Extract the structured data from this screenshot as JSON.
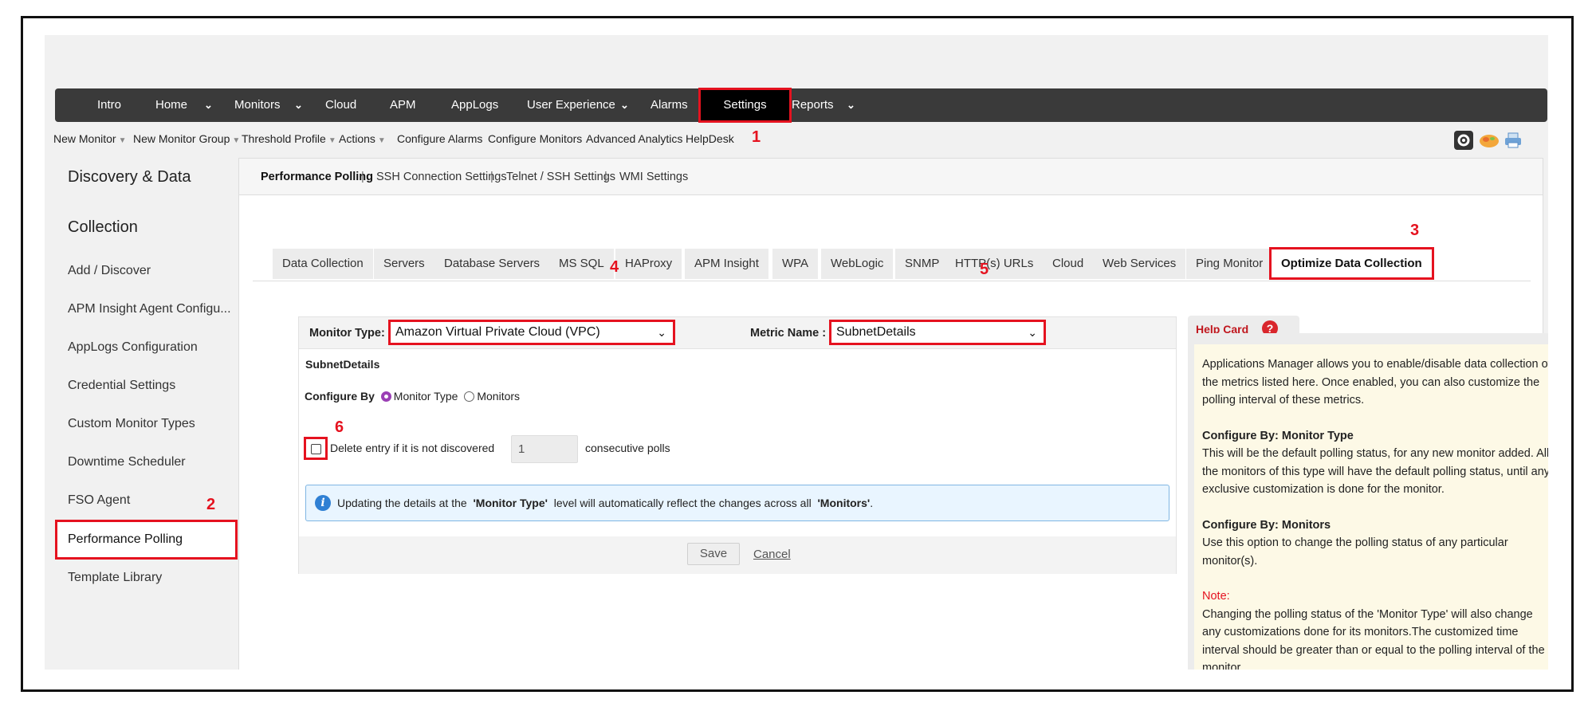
{
  "topnav": {
    "items": [
      "Intro",
      "Home",
      "Monitors",
      "Cloud",
      "APM",
      "AppLogs",
      "User Experience",
      "Alarms",
      "Settings",
      "Reports"
    ]
  },
  "submenu": {
    "items": [
      "New Monitor",
      "New Monitor Group",
      "Threshold Profile",
      "Actions",
      "Configure Alarms",
      "Configure Monitors",
      "Advanced Analytics",
      "HelpDesk"
    ]
  },
  "sidebar": {
    "heading_line1": "Discovery & Data",
    "heading_line2": "Collection",
    "items": [
      "Add / Discover",
      "APM Insight Agent Configu...",
      "AppLogs Configuration",
      "Credential Settings",
      "Custom Monitor Types",
      "Downtime Scheduler",
      "FSO Agent",
      "Performance Polling",
      "Template Library"
    ]
  },
  "main_tabs": {
    "items": [
      "Performance Polling",
      "SSH Connection Settings",
      "Telnet / SSH Settings",
      "WMI Settings"
    ],
    "separator": "|"
  },
  "sub_tabs": {
    "items": [
      "Data Collection",
      "Servers",
      "Database Servers",
      "MS SQL",
      "HAProxy",
      "APM Insight",
      "WPA",
      "WebLogic",
      "SNMP",
      "HTTP(s) URLs",
      "Cloud",
      "Web Services",
      "Ping Monitor",
      "Optimize Data Collection"
    ]
  },
  "form": {
    "monitor_type_label": "Monitor Type:",
    "monitor_type_value": "Amazon Virtual Private Cloud (VPC)",
    "metric_name_label": "Metric Name :",
    "metric_name_value": "SubnetDetails",
    "section_title": "SubnetDetails",
    "configure_by_label": "Configure By",
    "radio_monitor_type": "Monitor Type",
    "radio_monitors": "Monitors",
    "delete_entry_label": "Delete entry if it is not discovered",
    "polls_value": "1",
    "polls_suffix": "consecutive polls",
    "info_prefix": "Updating the details at the",
    "info_bold1": "'Monitor Type'",
    "info_middle": "level will automatically reflect the changes across all",
    "info_bold2": "'Monitors'",
    "info_suffix": ".",
    "save_label": "Save",
    "cancel_label": "Cancel"
  },
  "help_card": {
    "title": "Help Card",
    "intro": "Applications Manager allows you to enable/disable data collection of the metrics listed here. Once enabled, you can also customize the polling interval of these metrics.",
    "h1": "Configure By: Monitor Type",
    "p1": "This will be the default polling status, for any new monitor added. All the monitors of this type will have the default polling status, until any exclusive customization is done for the monitor.",
    "h2": "Configure By: Monitors",
    "p2": "Use this option to change the polling status of any particular monitor(s).",
    "note_label": "Note:",
    "note": "Changing the polling status of the 'Monitor Type' will also change any customizations done for its monitors.The customized time interval should be greater than or equal to the polling interval of the monitor."
  },
  "annotations": [
    "1",
    "2",
    "3",
    "4",
    "5",
    "6"
  ],
  "colors": {
    "highlight": "#e5121f",
    "nav_bg": "#3a3a3a",
    "radio_accent": "#9b3fb5",
    "help_title": "#c0161d"
  }
}
